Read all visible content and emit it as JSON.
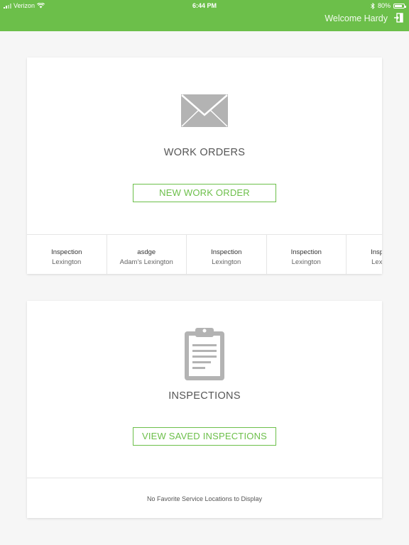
{
  "status_bar": {
    "carrier": "Verizon",
    "time": "6:44 PM",
    "battery": "80%"
  },
  "header": {
    "welcome_text": "Welcome Hardy",
    "accent_color": "#6cbf4a"
  },
  "work_orders": {
    "icon": "mail-icon",
    "title": "WORK ORDERS",
    "button_label": "NEW WORK ORDER",
    "recent_items": [
      {
        "title": "Inspection",
        "location": "Lexington"
      },
      {
        "title": "asdge",
        "location": "Adam's Lexington"
      },
      {
        "title": "Inspection",
        "location": "Lexington"
      },
      {
        "title": "Inspection",
        "location": "Lexington"
      },
      {
        "title": "Inspection",
        "location": "Lexington"
      }
    ]
  },
  "inspections": {
    "icon": "clipboard-icon",
    "title": "INSPECTIONS",
    "button_label": "VIEW SAVED INSPECTIONS",
    "footer_text": "No Favorite Service Locations to Display"
  }
}
